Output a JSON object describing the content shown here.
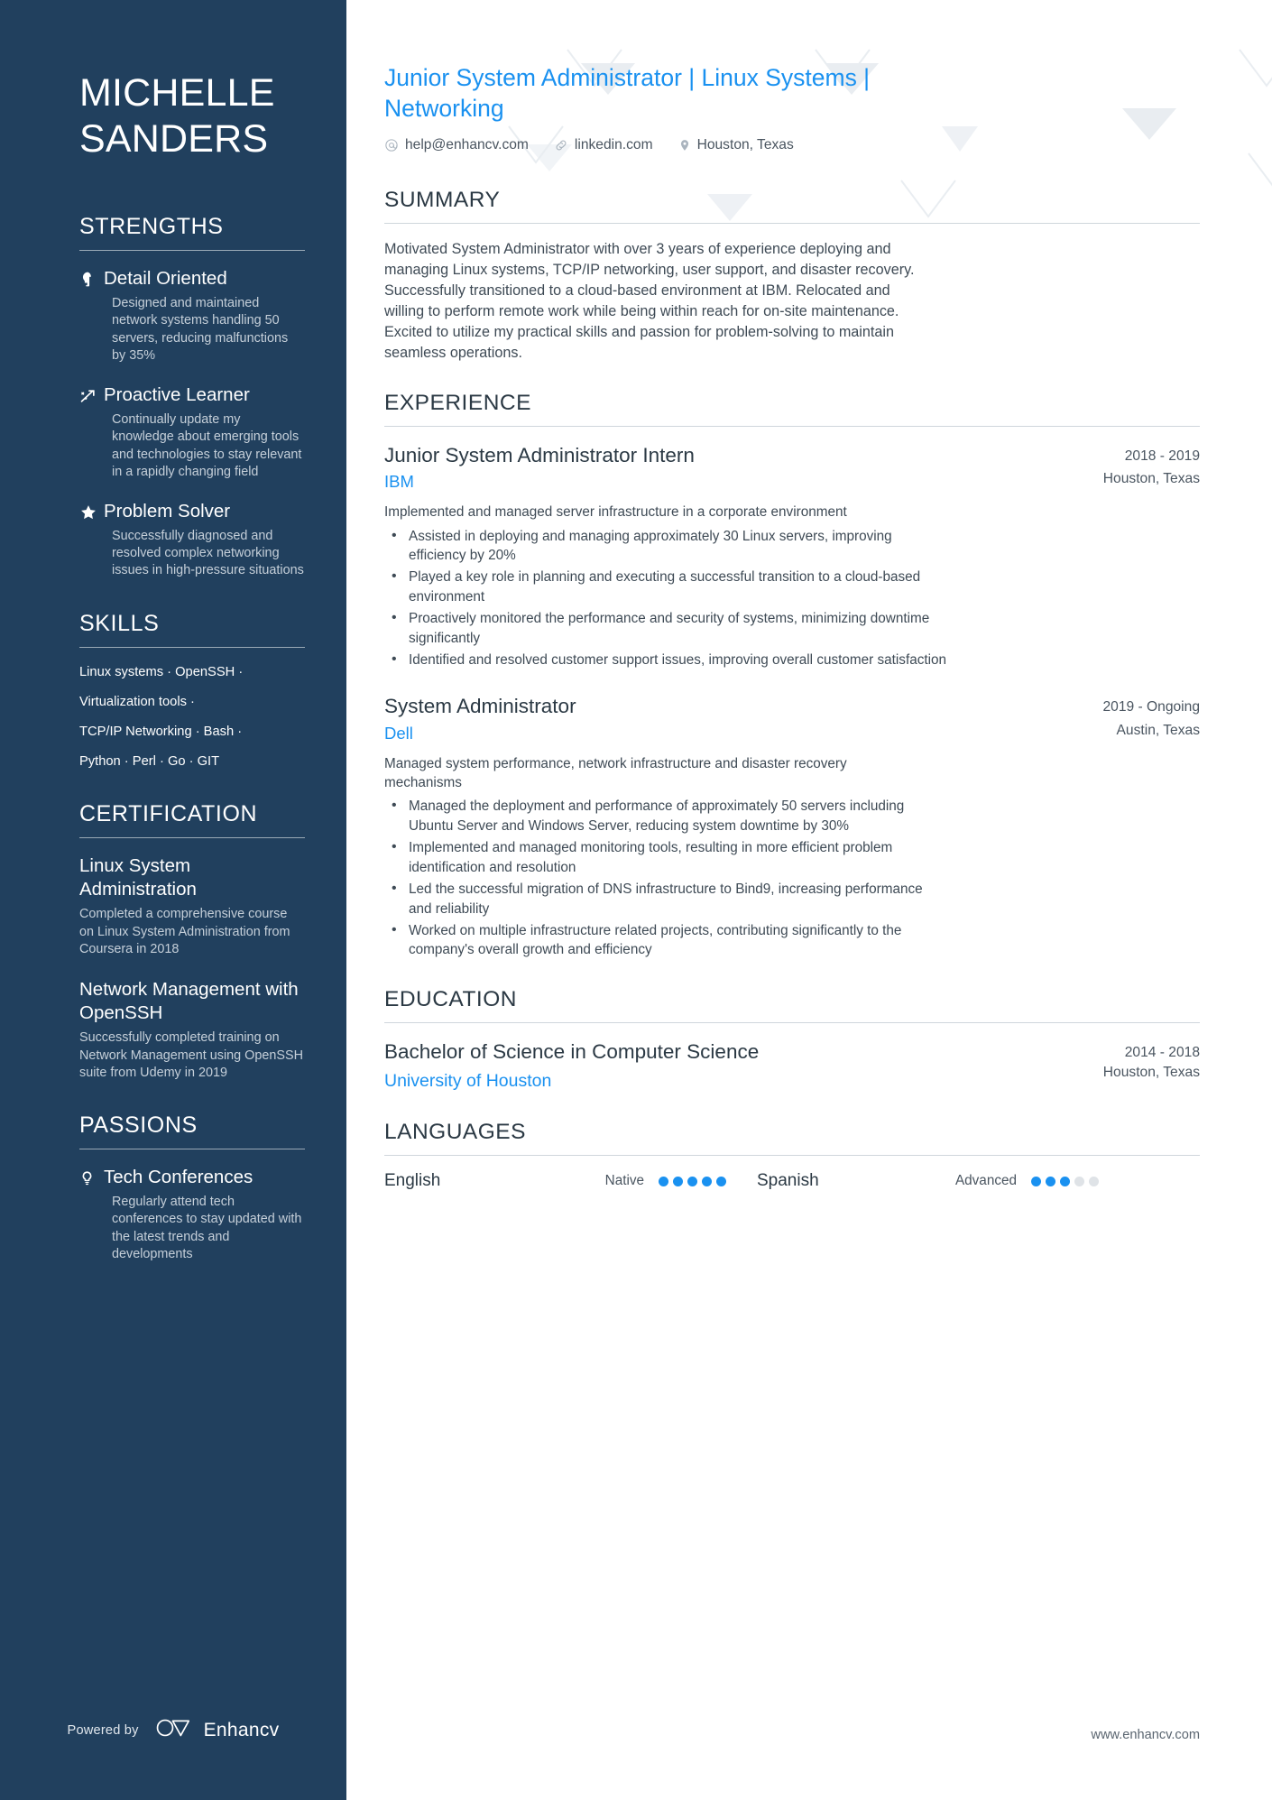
{
  "sidebar": {
    "name": "MICHELLE\nSANDERS",
    "strengths": {
      "title": "STRENGTHS",
      "items": [
        {
          "icon": "head-idea-icon",
          "name": "Detail Oriented",
          "desc": "Designed and maintained network systems handling 50 servers, reducing malfunctions by 35%"
        },
        {
          "icon": "growth-arrow-icon",
          "name": "Proactive Learner",
          "desc": "Continually update my knowledge about emerging tools and technologies to stay relevant in a rapidly changing field"
        },
        {
          "icon": "star-icon",
          "name": "Problem Solver",
          "desc": "Successfully diagnosed and resolved complex networking issues in high-pressure situations"
        }
      ]
    },
    "skills": {
      "title": "SKILLS",
      "lines": [
        "Linux systems · OpenSSH ·",
        "Virtualization tools ·",
        "TCP/IP Networking · Bash ·",
        "Python · Perl · Go · GIT"
      ]
    },
    "certification": {
      "title": "CERTIFICATION",
      "items": [
        {
          "name": "Linux System Administration",
          "desc": "Completed a comprehensive course on Linux System Administration from Coursera in 2018"
        },
        {
          "name": "Network Management with OpenSSH",
          "desc": "Successfully completed training on Network Management using OpenSSH suite from Udemy in 2019"
        }
      ]
    },
    "passions": {
      "title": "PASSIONS",
      "items": [
        {
          "icon": "lightbulb-icon",
          "name": "Tech Conferences",
          "desc": "Regularly attend tech conferences to stay updated with the latest trends and developments"
        }
      ]
    },
    "footer": {
      "powered_by": "Powered by",
      "brand": "Enhancv"
    }
  },
  "main": {
    "headline": "Junior System Administrator | Linux Systems | Networking",
    "contacts": [
      {
        "icon": "at-icon",
        "text": "help@enhancv.com"
      },
      {
        "icon": "link-icon",
        "text": "linkedin.com"
      },
      {
        "icon": "location-pin-icon",
        "text": "Houston, Texas"
      }
    ],
    "summary": {
      "title": "SUMMARY",
      "text": "Motivated System Administrator with over 3 years of experience deploying and managing Linux systems, TCP/IP networking, user support, and disaster recovery. Successfully transitioned to a cloud-based environment at IBM. Relocated and willing to perform remote work while being within reach for on-site maintenance. Excited to utilize my practical skills and passion for problem-solving to maintain seamless operations."
    },
    "experience": {
      "title": "EXPERIENCE",
      "jobs": [
        {
          "title": "Junior System Administrator Intern",
          "dates": "2018 - 2019",
          "company": "IBM",
          "location": "Houston, Texas",
          "desc": "Implemented and managed server infrastructure in a corporate environment",
          "bullets": [
            "Assisted in deploying and managing approximately 30 Linux servers, improving efficiency by 20%",
            "Played a key role in planning and executing a successful transition to a cloud-based environment",
            "Proactively monitored the performance and security of systems, minimizing downtime significantly",
            "Identified and resolved customer support issues, improving overall customer satisfaction"
          ]
        },
        {
          "title": "System Administrator",
          "dates": "2019 - Ongoing",
          "company": "Dell",
          "location": "Austin, Texas",
          "desc": "Managed system performance, network infrastructure and disaster recovery mechanisms",
          "bullets": [
            "Managed the deployment and performance of approximately 50 servers including Ubuntu Server and Windows Server, reducing system downtime by 30%",
            "Implemented and managed monitoring tools, resulting in more efficient problem identification and resolution",
            "Led the successful migration of DNS infrastructure to Bind9, increasing performance and reliability",
            "Worked on multiple infrastructure related projects, contributing significantly to the company's overall growth and efficiency"
          ]
        }
      ]
    },
    "education": {
      "title": "EDUCATION",
      "entries": [
        {
          "degree": "Bachelor of Science in Computer Science",
          "dates": "2014 - 2018",
          "school": "University of Houston",
          "location": "Houston, Texas"
        }
      ]
    },
    "languages": {
      "title": "LANGUAGES",
      "items": [
        {
          "name": "English",
          "level": "Native",
          "filled": 5,
          "total": 5
        },
        {
          "name": "Spanish",
          "level": "Advanced",
          "filled": 3,
          "total": 5
        }
      ]
    },
    "site_url": "www.enhancv.com"
  },
  "colors": {
    "sidebar_bg": "#21405e",
    "accent_blue": "#1a91f0",
    "heading_dark": "#2b3944"
  }
}
